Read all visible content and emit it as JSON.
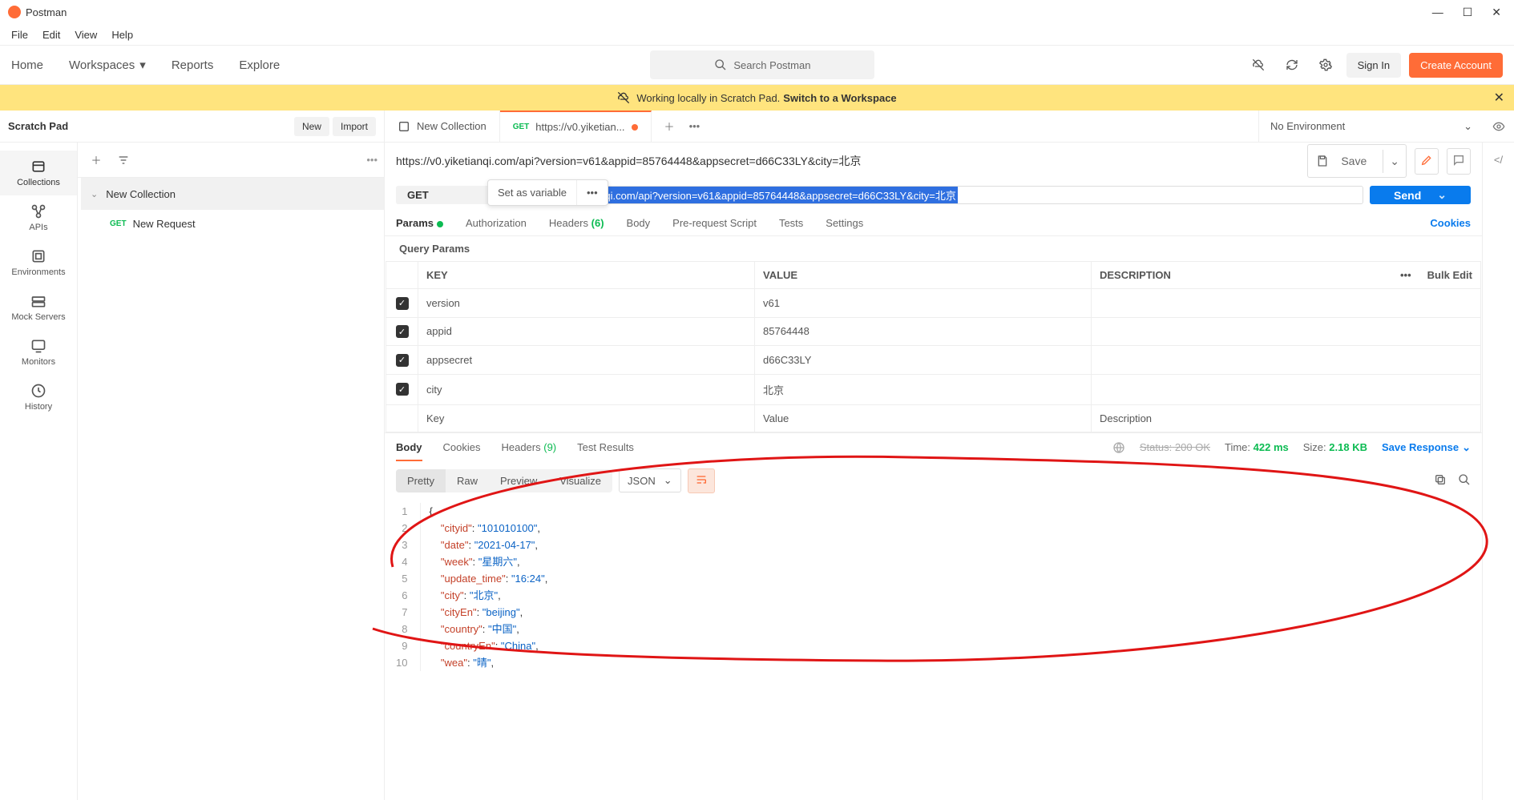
{
  "titlebar": {
    "app": "Postman"
  },
  "menu": {
    "file": "File",
    "edit": "Edit",
    "view": "View",
    "help": "Help"
  },
  "header": {
    "home": "Home",
    "workspaces": "Workspaces",
    "reports": "Reports",
    "explore": "Explore",
    "search_placeholder": "Search Postman",
    "sign_in": "Sign In",
    "create_account": "Create Account"
  },
  "banner": {
    "text": "Working locally in Scratch Pad.",
    "link": "Switch to a Workspace"
  },
  "workspace": {
    "name": "Scratch Pad",
    "new_btn": "New",
    "import_btn": "Import",
    "tabs": [
      {
        "label": "New Collection",
        "kind": "collection"
      },
      {
        "method": "GET",
        "label": "https://v0.yiketian...",
        "kind": "request",
        "unsaved": true
      }
    ],
    "env": "No Environment"
  },
  "rail": {
    "collections": "Collections",
    "apis": "APIs",
    "environments": "Environments",
    "mock": "Mock Servers",
    "monitors": "Monitors",
    "history": "History"
  },
  "sidebar": {
    "collection": "New Collection",
    "request_method": "GET",
    "request_name": "New Request"
  },
  "request": {
    "breadcrumb": "https://v0.yiketianqi.com/api?version=v61&appid=85764448&appsecret=d66C33LY&city=北京",
    "var_popup": "Set as variable",
    "method": "GET",
    "url": "https://v0.yiketianqi.com/api?version=v61&appid=85764448&appsecret=d66C33LY&city=北京",
    "send": "Send",
    "save": "Save",
    "tabs": {
      "params": "Params",
      "auth": "Authorization",
      "headers": "Headers",
      "headers_count": "(6)",
      "body": "Body",
      "prereq": "Pre-request Script",
      "tests": "Tests",
      "settings": "Settings",
      "cookies": "Cookies"
    },
    "section": "Query Params",
    "table": {
      "key_h": "KEY",
      "val_h": "VALUE",
      "desc_h": "DESCRIPTION",
      "bulk": "Bulk Edit",
      "rows": [
        {
          "k": "version",
          "v": "v61"
        },
        {
          "k": "appid",
          "v": "85764448"
        },
        {
          "k": "appsecret",
          "v": "d66C33LY"
        },
        {
          "k": "city",
          "v": "北京"
        }
      ],
      "ph_key": "Key",
      "ph_val": "Value",
      "ph_desc": "Description"
    }
  },
  "response": {
    "tabs": {
      "body": "Body",
      "cookies": "Cookies",
      "headers": "Headers",
      "headers_count": "(9)",
      "tests": "Test Results"
    },
    "status_label": "Status:",
    "status": "200 OK",
    "time_label": "Time:",
    "time": "422 ms",
    "size_label": "Size:",
    "size": "2.18 KB",
    "save": "Save Response",
    "view": {
      "pretty": "Pretty",
      "raw": "Raw",
      "preview": "Preview",
      "visualize": "Visualize",
      "fmt": "JSON"
    },
    "json_lines": [
      {
        "n": 1,
        "html": "<span class='p'>{</span>"
      },
      {
        "n": 2,
        "html": "    <span class='k'>\"cityid\"</span><span class='p'>: </span><span class='s'>\"101010100\"</span><span class='p'>,</span>"
      },
      {
        "n": 3,
        "html": "    <span class='k'>\"date\"</span><span class='p'>: </span><span class='s'>\"2021-04-17\"</span><span class='p'>,</span>"
      },
      {
        "n": 4,
        "html": "    <span class='k'>\"week\"</span><span class='p'>: </span><span class='s'>\"星期六\"</span><span class='p'>,</span>"
      },
      {
        "n": 5,
        "html": "    <span class='k'>\"update_time\"</span><span class='p'>: </span><span class='s'>\"16:24\"</span><span class='p'>,</span>"
      },
      {
        "n": 6,
        "html": "    <span class='k'>\"city\"</span><span class='p'>: </span><span class='s'>\"北京\"</span><span class='p'>,</span>"
      },
      {
        "n": 7,
        "html": "    <span class='k'>\"cityEn\"</span><span class='p'>: </span><span class='s'>\"beijing\"</span><span class='p'>,</span>"
      },
      {
        "n": 8,
        "html": "    <span class='k'>\"country\"</span><span class='p'>: </span><span class='s'>\"中国\"</span><span class='p'>,</span>"
      },
      {
        "n": 9,
        "html": "    <span class='k'>\"countryEn\"</span><span class='p'>: </span><span class='s'>\"China\"</span><span class='p'>,</span>"
      },
      {
        "n": 10,
        "html": "    <span class='k'>\"wea\"</span><span class='p'>: </span><span class='s'>\"晴\"</span><span class='p'>,</span>"
      }
    ]
  }
}
